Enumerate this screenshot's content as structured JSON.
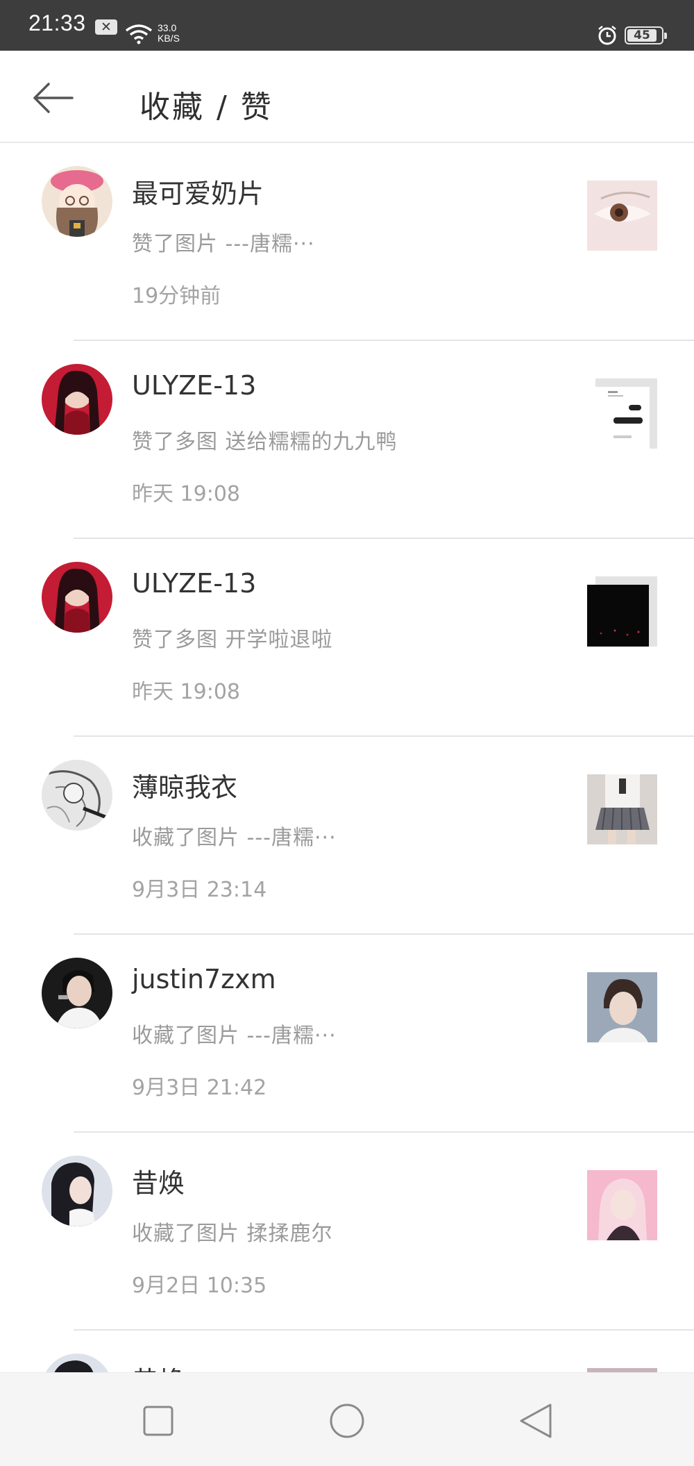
{
  "status_bar": {
    "time": "21:33",
    "speed_value": "33.0",
    "speed_unit": "KB/S",
    "battery": "45",
    "icons": [
      "x-notification-icon",
      "wifi-icon",
      "alarm-icon",
      "battery-icon"
    ]
  },
  "header": {
    "title": "收藏 / 赞",
    "back_icon": "back-arrow-icon"
  },
  "notifications": [
    {
      "user": "最可爱奶片",
      "action": "赞了图片 ---唐糯···",
      "time": "19分钟前"
    },
    {
      "user": "ULYZE-13",
      "action": "赞了多图 送给糯糯的九九鸭",
      "time": "昨天 19:08"
    },
    {
      "user": "ULYZE-13",
      "action": "赞了多图 开学啦退啦",
      "time": "昨天 19:08"
    },
    {
      "user": "薄晾我衣",
      "action": "收藏了图片 ---唐糯···",
      "time": "9月3日 23:14"
    },
    {
      "user": "justin7zxm",
      "action": "收藏了图片 ---唐糯···",
      "time": "9月3日 21:42"
    },
    {
      "user": "昔焕",
      "action": "收藏了图片 揉揉鹿尔",
      "time": "9月2日 10:35"
    },
    {
      "user": "昔焕",
      "action": "",
      "time": ""
    }
  ],
  "nav_bar": {
    "icons": [
      "recent-apps-icon",
      "home-icon",
      "back-icon"
    ]
  },
  "colors": {
    "status_bar": "#3d3d3d",
    "title": "#2f2f2f",
    "secondary_text": "#9a9a9a",
    "divider": "#e4e4e4"
  }
}
